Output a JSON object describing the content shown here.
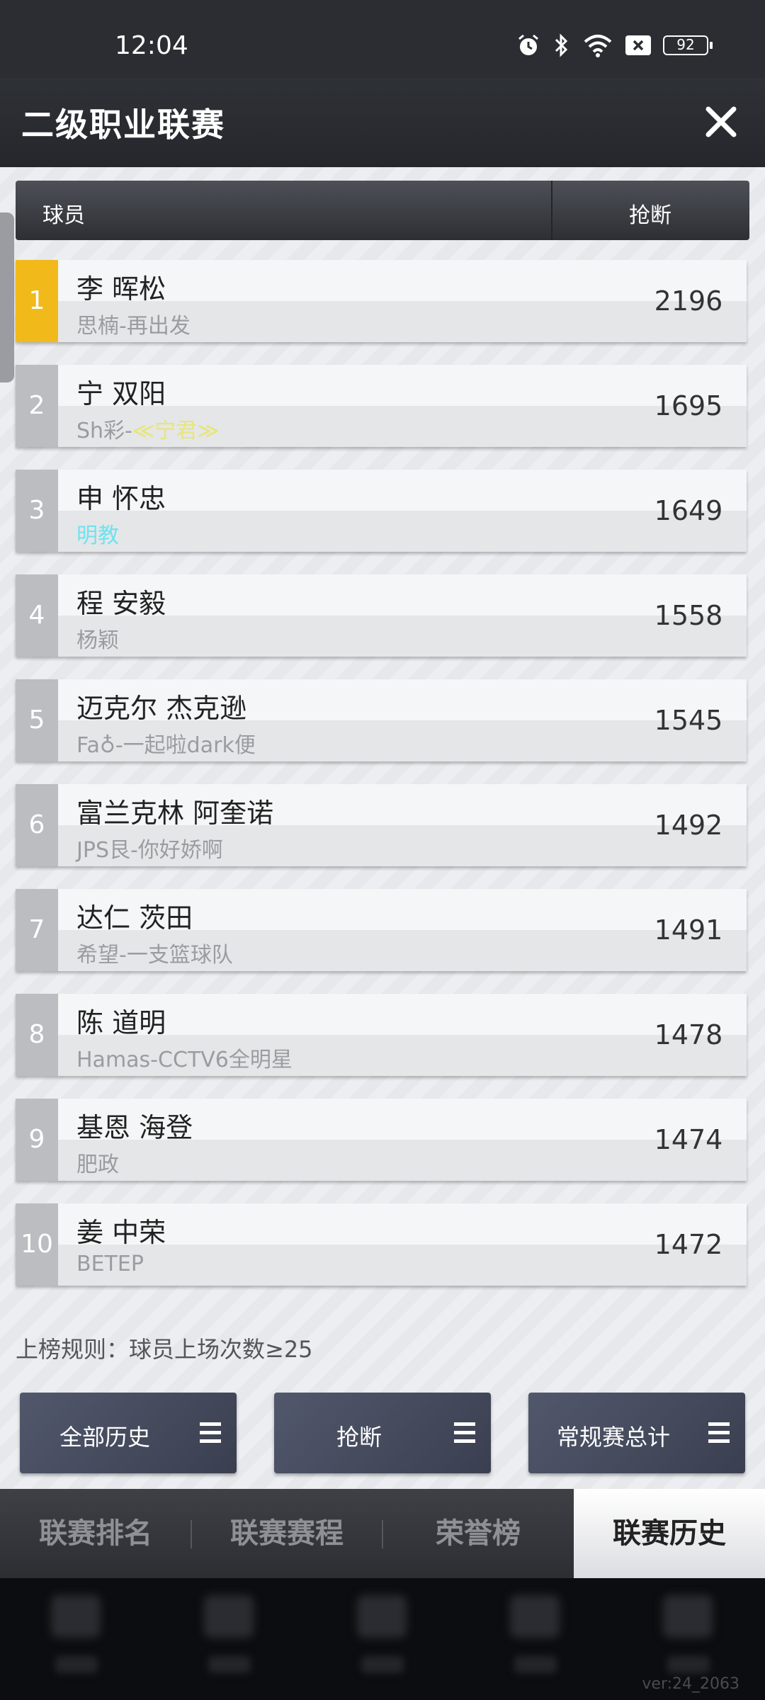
{
  "status": {
    "time": "12:04",
    "battery": "92"
  },
  "title": "二级职业联赛",
  "table": {
    "col_player": "球员",
    "col_stat": "抢断",
    "rows": [
      {
        "rank": "1",
        "name": "李 晖松",
        "team": "思楠-再出发",
        "value": "2196"
      },
      {
        "rank": "2",
        "name": "宁 双阳",
        "team_prefix": "Sh彩-",
        "team": "≪宁君≫",
        "value": "1695"
      },
      {
        "rank": "3",
        "name": "申 怀忠",
        "team": "明教",
        "value": "1649"
      },
      {
        "rank": "4",
        "name": "程 安毅",
        "team": "杨颖",
        "value": "1558"
      },
      {
        "rank": "5",
        "name": "迈克尔 杰克逊",
        "team": "Fa♁-一起啦dark便",
        "value": "1545"
      },
      {
        "rank": "6",
        "name": "富兰克林 阿奎诺",
        "team": "JPS艮-你好娇啊",
        "value": "1492"
      },
      {
        "rank": "7",
        "name": "达仁 茨田",
        "team": "希望-一支篮球队",
        "value": "1491"
      },
      {
        "rank": "8",
        "name": "陈 道明",
        "team": "Hamas-CCTV6全明星",
        "value": "1478"
      },
      {
        "rank": "9",
        "name": "基恩 海登",
        "team": "肥政",
        "value": "1474"
      },
      {
        "rank": "10",
        "name": "姜 中荣",
        "team": "BETEP",
        "value": "1472"
      }
    ]
  },
  "rule": "上榜规则：球员上场次数≥25",
  "filters": {
    "history": "全部历史",
    "stat": "抢断",
    "season": "常规赛总计"
  },
  "tabs": {
    "ranking": "联赛排名",
    "schedule": "联赛赛程",
    "honors": "荣誉榜",
    "history": "联赛历史"
  },
  "version": "ver:24_2063",
  "colors": {
    "gold": "#f2b91a",
    "team_yellow": "#e6e67a",
    "team_cyan": "#6fe3ee"
  }
}
